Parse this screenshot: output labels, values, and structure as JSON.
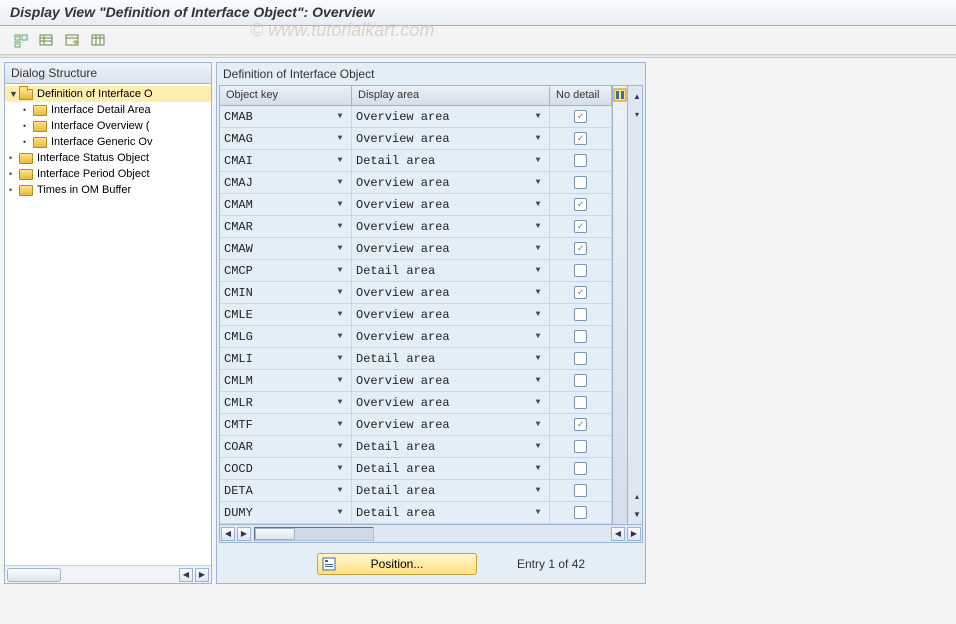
{
  "watermark": "© www.tutorialkart.com",
  "title": "Display View \"Definition of Interface Object\": Overview",
  "dialog": {
    "header": "Dialog Structure",
    "tree": [
      {
        "label": "Definition of Interface O",
        "level": 0,
        "expanded": true,
        "selected": true
      },
      {
        "label": "Interface Detail Area",
        "level": 1
      },
      {
        "label": "Interface Overview (",
        "level": 1
      },
      {
        "label": "Interface Generic Ov",
        "level": 1
      },
      {
        "label": "Interface Status Object",
        "level": 0
      },
      {
        "label": "Interface Period Object",
        "level": 0
      },
      {
        "label": "Times in OM Buffer",
        "level": 0
      }
    ]
  },
  "table": {
    "title": "Definition of Interface Object",
    "columns": {
      "key": "Object key",
      "area": "Display area",
      "nodetail": "No detail"
    },
    "rows": [
      {
        "key": "CMAB",
        "area": "Overview area",
        "nd": true
      },
      {
        "key": "CMAG",
        "area": "Overview area",
        "nd": true
      },
      {
        "key": "CMAI",
        "area": "Detail area",
        "nd": false
      },
      {
        "key": "CMAJ",
        "area": "Overview area",
        "nd": false
      },
      {
        "key": "CMAM",
        "area": "Overview area",
        "nd": true
      },
      {
        "key": "CMAR",
        "area": "Overview area",
        "nd": true
      },
      {
        "key": "CMAW",
        "area": "Overview area",
        "nd": true
      },
      {
        "key": "CMCP",
        "area": "Detail area",
        "nd": false
      },
      {
        "key": "CMIN",
        "area": "Overview area",
        "nd": true
      },
      {
        "key": "CMLE",
        "area": "Overview area",
        "nd": false
      },
      {
        "key": "CMLG",
        "area": "Overview area",
        "nd": false
      },
      {
        "key": "CMLI",
        "area": "Detail area",
        "nd": false
      },
      {
        "key": "CMLM",
        "area": "Overview area",
        "nd": false
      },
      {
        "key": "CMLR",
        "area": "Overview area",
        "nd": false
      },
      {
        "key": "CMTF",
        "area": "Overview area",
        "nd": true
      },
      {
        "key": "COAR",
        "area": "Detail area",
        "nd": false
      },
      {
        "key": "COCD",
        "area": "Detail area",
        "nd": false
      },
      {
        "key": "DETA",
        "area": "Detail area",
        "nd": false
      },
      {
        "key": "DUMY",
        "area": "Detail area",
        "nd": false
      }
    ]
  },
  "footer": {
    "position": "Position...",
    "entry": "Entry 1 of 42"
  }
}
